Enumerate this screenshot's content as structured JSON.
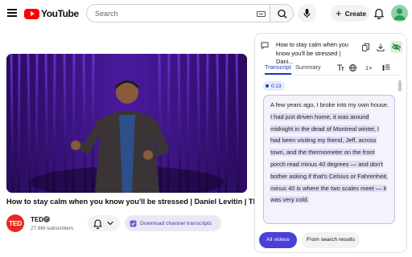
{
  "header": {
    "logo_text": "YouTube",
    "search_placeholder": "Search",
    "create_label": "Create"
  },
  "video": {
    "title": "How to stay calm when you know you'll be stressed | Daniel Levitin | TED",
    "channel_avatar_text": "TED",
    "channel_name": "TED",
    "subscribers": "27.6M subscribers",
    "download_transcripts_label": "Download channel transcripts"
  },
  "panel": {
    "title": "How to stay calm when you know you'll be stressed | Dani...",
    "tabs": [
      "Transcript",
      "Summary"
    ],
    "speed": "1×",
    "timestamp": "0:13",
    "transcript_plain": "A few years ago, I broke into my own house.",
    "transcript_highlight": "I had just driven home, it was around midnight in the dead of Montreal winter, I had been visiting my friend, Jeff, across town, and the thermometer on the front porch read minus 40 degrees — and don't bother asking if that's Celsius or Fahrenheit, minus 40 is where the two scales meet — it was very cold.",
    "buttons": {
      "all_videos": "All videos",
      "search_results": "From search results"
    }
  },
  "colors": {
    "brand_red": "#ff0000",
    "accent_blue": "#1a3cc8",
    "highlight": "#e2dbf5",
    "primary_button": "#4a3fd6",
    "ted_red": "#e62b1e"
  }
}
